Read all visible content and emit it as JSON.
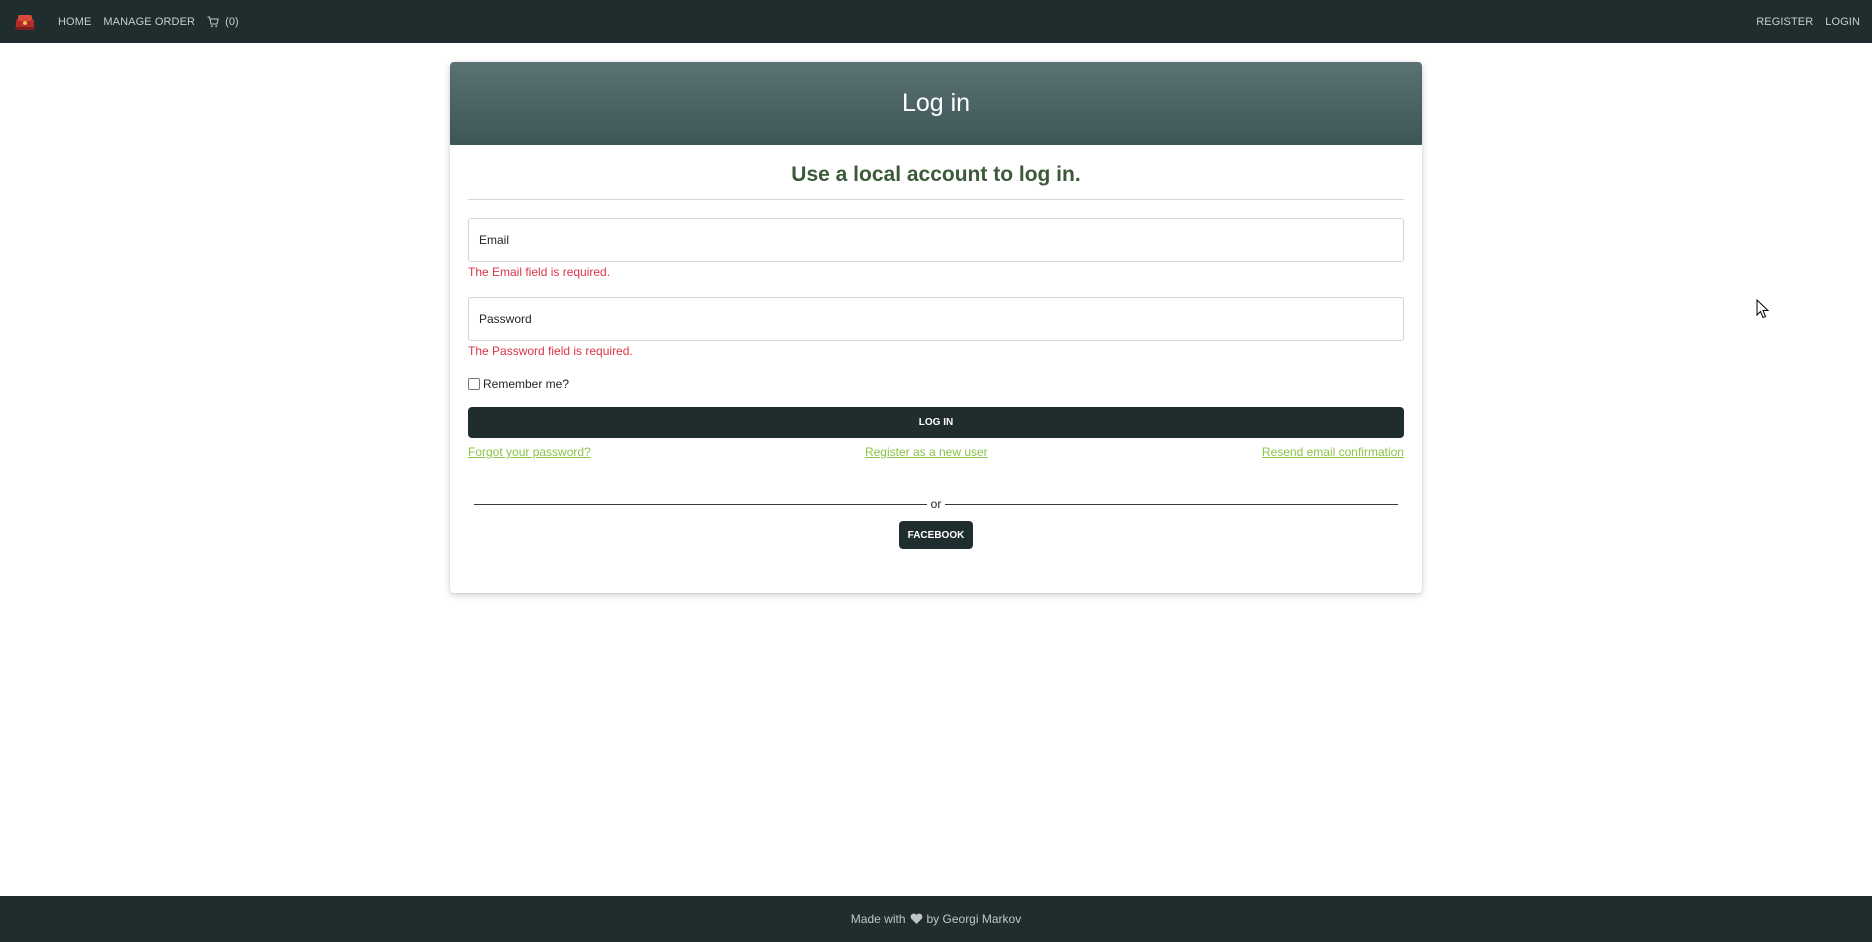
{
  "navbar": {
    "logo_icon": "restaurant-logo-icon",
    "home_label": "HOME",
    "manage_order_label": "MANAGE ORDER",
    "cart_icon": "cart-icon",
    "cart_count": "(0)",
    "register_label": "REGISTER",
    "login_label": "LOGIN"
  },
  "card": {
    "title": "Log in",
    "subtitle": "Use a local account to log in.",
    "email_placeholder": "Email",
    "email_error": "The Email field is required.",
    "password_placeholder": "Password",
    "password_error": "The Password field is required.",
    "remember_label": "Remember me?",
    "remember_checked": false,
    "login_button": "LOG IN",
    "forgot_link": "Forgot your password?",
    "register_link": "Register as a new user",
    "resend_link": "Resend email confirmation",
    "or_label": "or",
    "facebook_button": "FACEBOOK"
  },
  "footer": {
    "made_with": "Made with",
    "heart_icon": "heart-icon",
    "by_text": "by Georgi Markov"
  },
  "colors": {
    "navbar_bg": "#1f2d2f",
    "header_gradient_top": "#5b7274",
    "header_gradient_bottom": "#3f5658",
    "error": "#dc3545",
    "link": "#8bc34a",
    "subtitle": "#3c5a3a"
  }
}
